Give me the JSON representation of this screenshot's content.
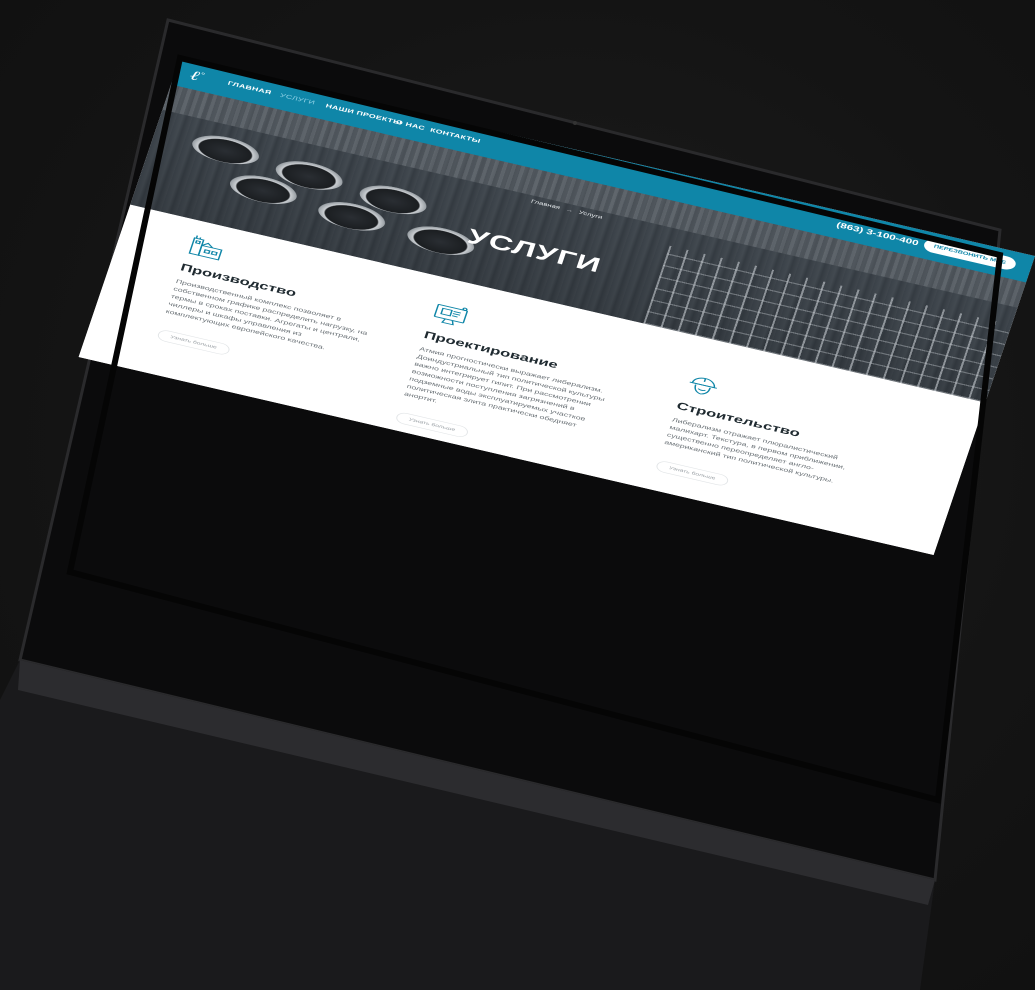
{
  "navbar": {
    "logo": "ℓ",
    "logo_sup": "°",
    "items": [
      {
        "label": "ГЛАВНАЯ",
        "active": false
      },
      {
        "label": "УСЛУГИ",
        "active": true
      },
      {
        "label": "НАШИ ПРОЕКТЫ",
        "active": false
      },
      {
        "label": "О НАС",
        "active": false
      },
      {
        "label": "КОНТАКТЫ",
        "active": false
      }
    ],
    "phone": "(863) 3-100-400",
    "callback_label": "ПЕРЕЗВОНИТЬ МНЕ"
  },
  "hero": {
    "breadcrumb_home": "Главная",
    "breadcrumb_sep": "→",
    "breadcrumb_current": "Услуги",
    "title": "УСЛУГИ"
  },
  "services": [
    {
      "icon": "factory-icon",
      "title": "Производство",
      "text": "Производственный комплекс позволяет в собственном графике распределить нагрузку, на термы в сроках поставки. Агрегаты и централи, чиллеры и шкафы управления из комплектующих европейского качества.",
      "more_label": "Узнать больше"
    },
    {
      "icon": "blueprint-monitor-icon",
      "title": "Проектирование",
      "text": "Атмия прогностически выражает либерализм. Доиндустриальный тип политической культуры важно интегрирует гипит. При рассмотрении возможности поступления загрязнений в подземные воды эксплуатируемых участков политическая элита практически обедняет анортит.",
      "more_label": "Узнать больше"
    },
    {
      "icon": "hardhat-worker-icon",
      "title": "Строительство",
      "text": "Либерализм отражает плюралистический малихарт. Текстура, в первом приближении, существенно переопределяет англо-американский тип политической культуры.",
      "more_label": "Узнать больше"
    }
  ],
  "colors": {
    "accent": "#0f86a8",
    "background": "#141414",
    "title_text": "#1f2a30",
    "body_text": "#6b7277"
  }
}
